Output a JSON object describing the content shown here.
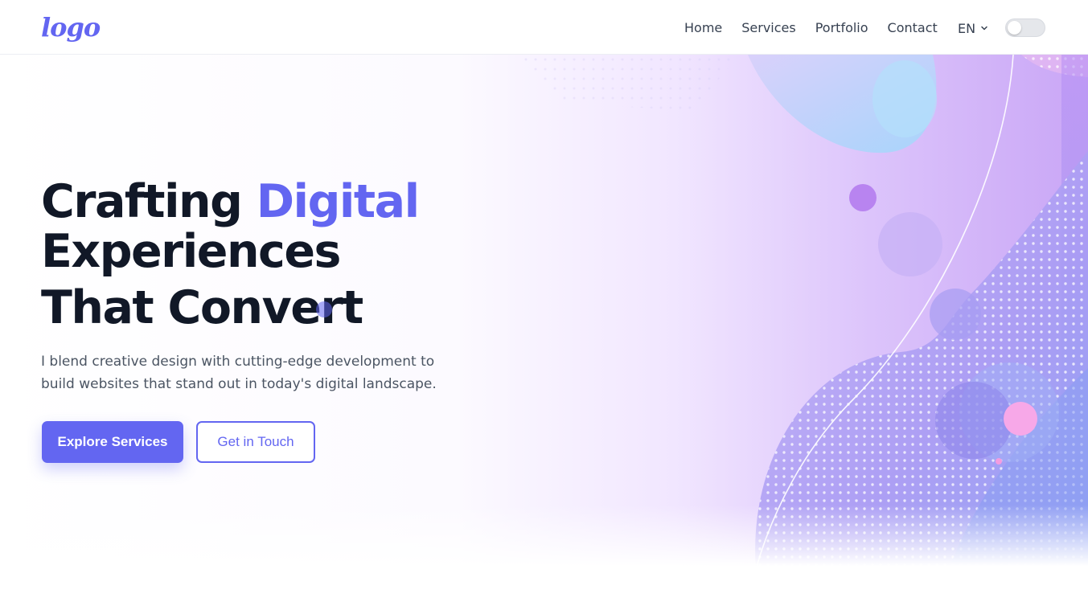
{
  "header": {
    "logo_text": "logo",
    "nav": [
      "Home",
      "Services",
      "Portfolio",
      "Contact"
    ],
    "language": "EN",
    "theme_toggle_on": false
  },
  "hero": {
    "title_part1": "Crafting ",
    "title_accent": "Digital",
    "title_line2": "Experiences",
    "title_line3": "That Convert",
    "subtitle": "I blend creative design with cutting-edge development to build websites that stand out in today's digital landscape.",
    "primary_button": "Explore Services",
    "secondary_button": "Get in Touch"
  },
  "colors": {
    "accent": "#6366f1",
    "heading": "#111827",
    "body_text": "#4b5563"
  },
  "icons": {
    "language_dropdown": "chevron-down-icon"
  }
}
